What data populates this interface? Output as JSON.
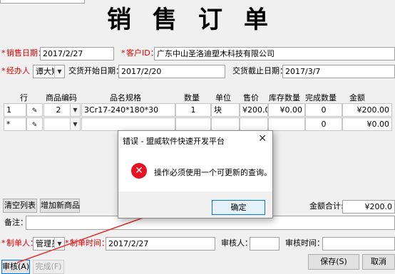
{
  "header": {
    "title": "销售订单"
  },
  "form": {
    "sale_date_label": "销售日期：",
    "sale_date_value": "2017/2/27",
    "customer_label": "客户ID：",
    "customer_value": "广东中山圣洛迪塑木科技有限公司",
    "handler_label": "经办人",
    "handler_value": "谭大矩",
    "delivery_start_label": "交货开始日期：",
    "delivery_start_value": "2017/2/20",
    "delivery_end_label": "交货截止日期：",
    "delivery_end_value": "2017/3/7"
  },
  "table": {
    "headers": [
      "行",
      "商品编码",
      "品名规格",
      "数量",
      "单位",
      "售价",
      "库存数量",
      "完成数量",
      "金额"
    ],
    "rows": [
      {
        "row": "1",
        "code": "2",
        "spec": "3Cr17-240*180*30",
        "qty": "1",
        "unit": "块",
        "price": "¥200.00",
        "stock": "¥0.00",
        "done": "0",
        "amount": "¥200.00"
      },
      {
        "row": "*",
        "code": "",
        "spec": "",
        "qty": "",
        "unit": "",
        "price": "",
        "stock": "",
        "done": "0",
        "amount": "¥0.00"
      }
    ]
  },
  "actions": {
    "clear_list": "清空列表",
    "add_product": "增加新商品",
    "total_label": "金额合计:",
    "total_value": "¥200.0",
    "remark_label": "备注：",
    "creator_label": "制单人：",
    "creator_value": "管理员",
    "create_time_label": "制单时间：",
    "create_time_value": "2017/2/27",
    "auditor_label": "审核人：",
    "audit_time_label": "审核时间：",
    "audit_button": "审核(A)",
    "complete_button": "完成(F)",
    "save_button": "保存(S)",
    "cancel_button": "取消"
  },
  "dialog": {
    "title": "错误 - 盟威软件快速开发平台",
    "message": "操作必须使用一个可更新的查询。",
    "ok_button": "确定"
  },
  "colors": {
    "required": "#e00000",
    "arrow": "#e53935",
    "error_icon": "#e81123"
  }
}
